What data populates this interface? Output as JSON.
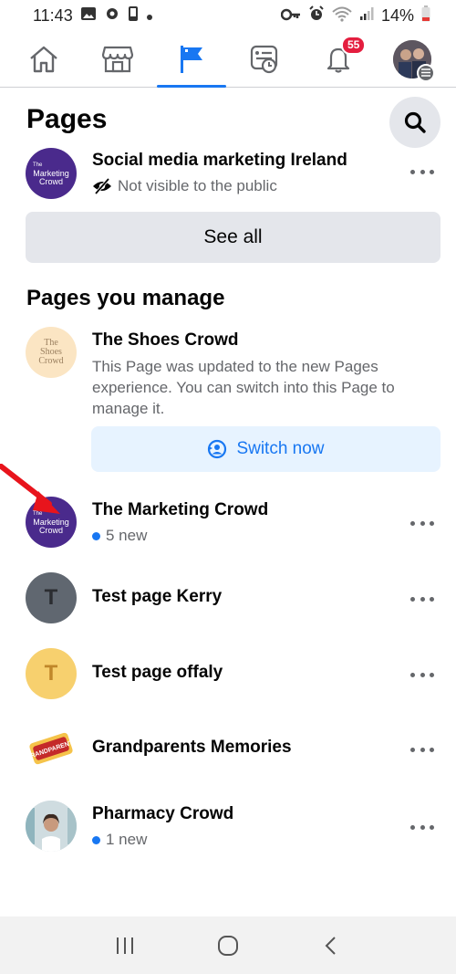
{
  "status_bar": {
    "time": "11:43",
    "battery": "14%"
  },
  "tabs": [
    {
      "name": "home",
      "icon": "home-icon"
    },
    {
      "name": "marketplace",
      "icon": "marketplace-icon"
    },
    {
      "name": "pages",
      "icon": "flag-icon",
      "active": true
    },
    {
      "name": "feeds",
      "icon": "memories-icon"
    },
    {
      "name": "notifications",
      "icon": "bell-icon",
      "badge": "55"
    },
    {
      "name": "menu",
      "icon": "profile-avatar"
    }
  ],
  "header": {
    "title": "Pages"
  },
  "top_page": {
    "name": "Social media marketing Ireland",
    "status": "Not visible to the public",
    "avatar_text": [
      "The",
      "Marketing",
      "Crowd"
    ]
  },
  "see_all_label": "See all",
  "section_title": "Pages you manage",
  "shoes": {
    "name": "The Shoes Crowd",
    "description": "This Page was updated to the new Pages experience. You can switch into this Page to manage it.",
    "avatar_text": [
      "The",
      "Shoes",
      "Crowd"
    ],
    "switch_label": "Switch now"
  },
  "managed_pages": [
    {
      "name": "The Marketing Crowd",
      "sub": "5 new",
      "avatar_text": [
        "The",
        "Marketing",
        "Crowd"
      ]
    },
    {
      "name": "Test page Kerry",
      "letter": "T"
    },
    {
      "name": "Test page offaly",
      "letter": "T"
    },
    {
      "name": "Grandparents Memories",
      "avatar_text": "GRANDPARENTS"
    },
    {
      "name": "Pharmacy Crowd",
      "sub": "1 new"
    }
  ],
  "colors": {
    "accent": "#1877f2",
    "badge": "#e41e3f",
    "annotation_arrow": "#e8141c"
  }
}
